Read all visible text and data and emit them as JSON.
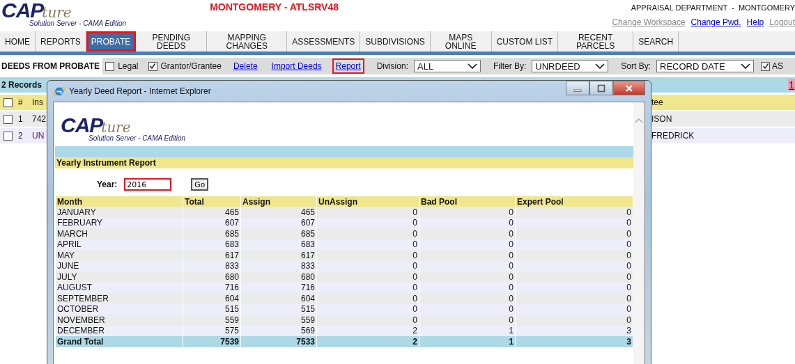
{
  "header": {
    "logo": {
      "main": "CAP",
      "script": "ture",
      "tagline": "Solution Server - CAMA Edition"
    },
    "site_title": "MONTGOMERY - ATLSRV48",
    "department": "APPRAISAL DEPARTMENT  -  MONTGOMERY",
    "links": [
      {
        "label": "Change Workspace",
        "disabled": true
      },
      {
        "label": "Change Pwd.",
        "disabled": false
      },
      {
        "label": "Help",
        "disabled": false
      },
      {
        "label": "Logout",
        "disabled": true
      }
    ]
  },
  "nav": [
    {
      "label": "HOME",
      "selected": false,
      "highlighted": false
    },
    {
      "label": "REPORTS",
      "selected": false,
      "highlighted": false
    },
    {
      "label": "PROBATE",
      "selected": true,
      "highlighted": true
    },
    {
      "label": "PENDING DEEDS",
      "selected": false,
      "highlighted": false
    },
    {
      "label": "MAPPING CHANGES",
      "selected": false,
      "highlighted": false
    },
    {
      "label": "ASSESSMENTS",
      "selected": false,
      "highlighted": false
    },
    {
      "label": "SUBDIVISIONS",
      "selected": false,
      "highlighted": false
    },
    {
      "label": "MAPS ONLINE",
      "selected": false,
      "highlighted": false
    },
    {
      "label": "CUSTOM LIST",
      "selected": false,
      "highlighted": false
    },
    {
      "label": "RECENT PARCELS",
      "selected": false,
      "highlighted": false
    },
    {
      "label": "SEARCH",
      "selected": false,
      "highlighted": false
    }
  ],
  "toolbar": {
    "title": "DEEDS FROM PROBATE",
    "checkboxes": [
      {
        "label": "Legal",
        "checked": false
      },
      {
        "label": "Grantor/Grantee",
        "checked": true
      }
    ],
    "links": [
      {
        "label": "Delete",
        "highlighted": false
      },
      {
        "label": "Import Deeds",
        "highlighted": false
      },
      {
        "label": "Report",
        "highlighted": true
      }
    ],
    "selects": [
      {
        "label": "Division:",
        "value": "ALL"
      },
      {
        "label": "Filter By:",
        "value": "UNRDEED"
      },
      {
        "label": "Sort By:",
        "value": "RECORD DATE"
      }
    ],
    "asc": {
      "label": "AS",
      "checked": true
    }
  },
  "records": {
    "count": "2 Records",
    "page_link": "1"
  },
  "table": {
    "header_checked": false,
    "columns": [
      "#",
      "Ins",
      "tee"
    ],
    "rows": [
      {
        "checked": false,
        "num": "1",
        "column_3": "742",
        "column_4": "ISON"
      },
      {
        "checked": false,
        "num": "2",
        "column_3": "UN",
        "column_4": "FREDRICK"
      }
    ]
  },
  "popup": {
    "title": "Yearly Deed Report - Internet Explorer",
    "logo": {
      "main": "CAP",
      "script": "ture",
      "tagline": "Solution Server - CAMA Edition"
    },
    "heading": "Yearly Instrument Report",
    "year_label": "Year:",
    "year_value": "2016",
    "year_highlighted": true,
    "go": "Go",
    "columns": [
      "Month",
      "Total",
      "Assign",
      "UnAssign",
      "Bad Pool",
      "Expert Pool"
    ],
    "rows": [
      [
        "JANUARY",
        "465",
        "465",
        "0",
        "0",
        "0"
      ],
      [
        "FEBRUARY",
        "607",
        "607",
        "0",
        "0",
        "0"
      ],
      [
        "MARCH",
        "685",
        "685",
        "0",
        "0",
        "0"
      ],
      [
        "APRIL",
        "683",
        "683",
        "0",
        "0",
        "0"
      ],
      [
        "MAY",
        "617",
        "617",
        "0",
        "0",
        "0"
      ],
      [
        "JUNE",
        "833",
        "833",
        "0",
        "0",
        "0"
      ],
      [
        "JULY",
        "680",
        "680",
        "0",
        "0",
        "0"
      ],
      [
        "AUGUST",
        "716",
        "716",
        "0",
        "0",
        "0"
      ],
      [
        "SEPTEMBER",
        "604",
        "604",
        "0",
        "0",
        "0"
      ],
      [
        "OCTOBER",
        "515",
        "515",
        "0",
        "0",
        "0"
      ],
      [
        "NOVEMBER",
        "559",
        "559",
        "0",
        "0",
        "0"
      ],
      [
        "DECEMBER",
        "575",
        "569",
        "2",
        "1",
        "3"
      ]
    ],
    "total": [
      "Grand Total",
      "7539",
      "7533",
      "2",
      "1",
      "3"
    ]
  }
}
